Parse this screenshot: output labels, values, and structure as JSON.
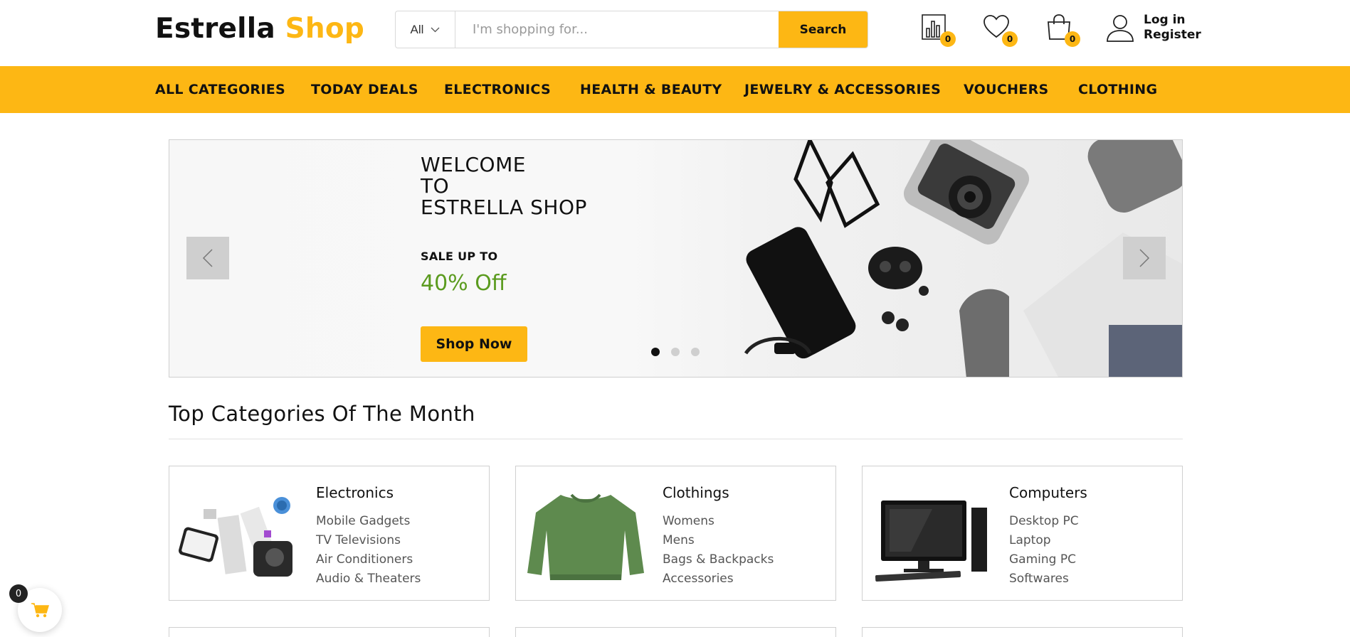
{
  "brand": {
    "part1": "Estrella",
    "part2": "Shop",
    "accent": "#fdb714"
  },
  "search": {
    "category": "All",
    "placeholder": "I'm shopping for...",
    "button": "Search"
  },
  "header_icons": {
    "compare": {
      "icon": "compare-chart-icon",
      "count": "0"
    },
    "wishlist": {
      "icon": "heart-icon",
      "count": "0"
    },
    "cart": {
      "icon": "shopping-bag-icon",
      "count": "0"
    }
  },
  "account": {
    "icon": "user-icon",
    "login": "Log in",
    "register": "Register"
  },
  "nav": [
    {
      "label": "ALL CATEGORIES"
    },
    {
      "label": "TODAY DEALS"
    },
    {
      "label": "ELECTRONICS"
    },
    {
      "label": "HEALTH & BEAUTY"
    },
    {
      "label": "JEWELRY & ACCESSORIES"
    },
    {
      "label": "VOUCHERS"
    },
    {
      "label": "CLOTHING"
    }
  ],
  "hero": {
    "title_line1": "WELCOME",
    "title_line2": "TO",
    "title_line3": "ESTRELLA SHOP",
    "sale_label": "SALE UP TO",
    "sale_value": "40% Off",
    "sale_color": "#5b9b1f",
    "cta": "Shop Now",
    "active_slide": 1,
    "slide_count": 3
  },
  "top_categories": {
    "title": "Top Categories Of The Month",
    "cards": [
      {
        "title": "Electronics",
        "image": "electronics-image",
        "items": [
          "Mobile Gadgets",
          "TV Televisions",
          "Air Conditioners",
          "Audio & Theaters"
        ]
      },
      {
        "title": "Clothings",
        "image": "sweater-image",
        "items": [
          "Womens",
          "Mens",
          "Bags & Backpacks",
          "Accessories"
        ]
      },
      {
        "title": "Computers",
        "image": "desktop-computer-image",
        "items": [
          "Desktop PC",
          "Laptop",
          "Gaming PC",
          "Softwares"
        ]
      }
    ]
  },
  "floating_cart": {
    "icon": "cart-icon",
    "count": "0"
  }
}
